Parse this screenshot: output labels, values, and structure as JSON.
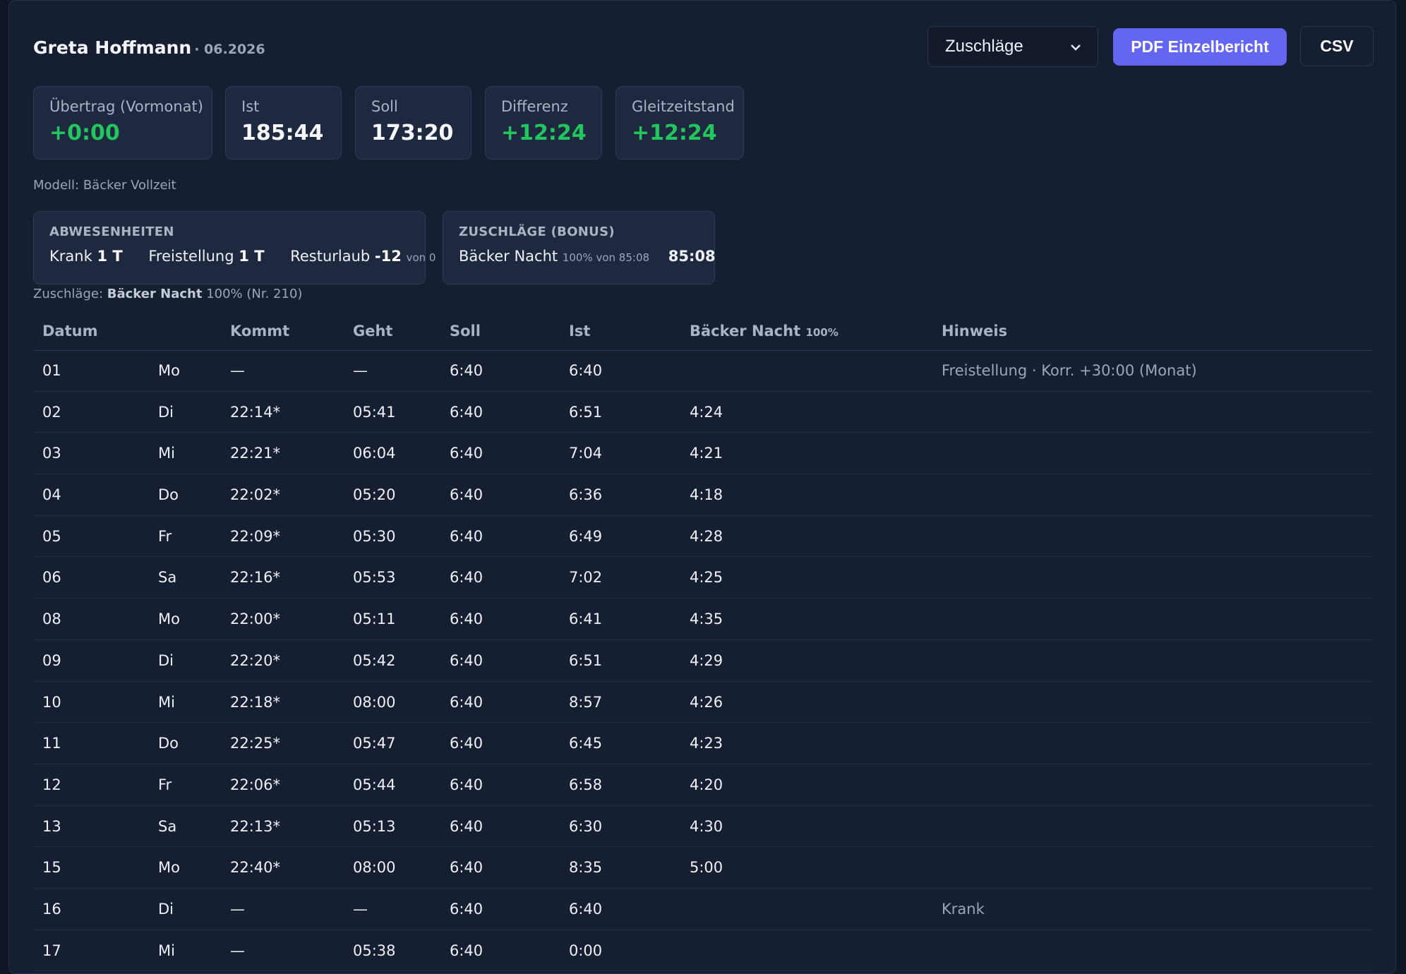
{
  "header": {
    "name": "Greta Hoffmann",
    "period": "· 06.2026",
    "select_value": "Zuschläge",
    "pdf_label": "PDF Einzelbericht",
    "csv_label": "CSV"
  },
  "stats": [
    {
      "label": "Übertrag (Vormonat)",
      "value": "+0:00"
    },
    {
      "label": "Ist",
      "value": "185:44"
    },
    {
      "label": "Soll",
      "value": "173:20"
    },
    {
      "label": "Differenz",
      "value": "+12:24"
    },
    {
      "label": "Gleitzeitstand",
      "value": "+12:24"
    }
  ],
  "model": "Modell: Bäcker Vollzeit",
  "absences": {
    "title": "ABWESENHEITEN",
    "krank_label": "Krank",
    "krank_value": "1 T",
    "freistellung_label": "Freistellung",
    "freistellung_value": "1 T",
    "resturlaub_label": "Resturlaub",
    "resturlaub_value": "-12",
    "resturlaub_suffix": "von 0"
  },
  "bonus": {
    "title": "ZUSCHLÄGE (BONUS)",
    "label": "Bäcker Nacht",
    "detail": "100% von 85:08",
    "value": "85:08"
  },
  "surcharge_note": {
    "prefix": "Zuschläge:",
    "name": "Bäcker Nacht",
    "suffix": "100% (Nr. 210)"
  },
  "table": {
    "headers": {
      "datum": "Datum",
      "kommt": "Kommt",
      "geht": "Geht",
      "soll": "Soll",
      "ist": "Ist",
      "bonus": "Bäcker Nacht",
      "bonus_pct": "100%",
      "hinweis": "Hinweis"
    },
    "rows": [
      {
        "day": "01",
        "wd": "Mo",
        "kommt": "—",
        "geht": "—",
        "soll": "6:40",
        "ist": "6:40",
        "bonus": "",
        "hint": "Freistellung · Korr. +30:00 (Monat)"
      },
      {
        "day": "02",
        "wd": "Di",
        "kommt": "22:14*",
        "geht": "05:41",
        "soll": "6:40",
        "ist": "6:51",
        "bonus": "4:24",
        "hint": ""
      },
      {
        "day": "03",
        "wd": "Mi",
        "kommt": "22:21*",
        "geht": "06:04",
        "soll": "6:40",
        "ist": "7:04",
        "bonus": "4:21",
        "hint": ""
      },
      {
        "day": "04",
        "wd": "Do",
        "kommt": "22:02*",
        "geht": "05:20",
        "soll": "6:40",
        "ist": "6:36",
        "bonus": "4:18",
        "hint": ""
      },
      {
        "day": "05",
        "wd": "Fr",
        "kommt": "22:09*",
        "geht": "05:30",
        "soll": "6:40",
        "ist": "6:49",
        "bonus": "4:28",
        "hint": ""
      },
      {
        "day": "06",
        "wd": "Sa",
        "kommt": "22:16*",
        "geht": "05:53",
        "soll": "6:40",
        "ist": "7:02",
        "bonus": "4:25",
        "hint": ""
      },
      {
        "day": "08",
        "wd": "Mo",
        "kommt": "22:00*",
        "geht": "05:11",
        "soll": "6:40",
        "ist": "6:41",
        "bonus": "4:35",
        "hint": ""
      },
      {
        "day": "09",
        "wd": "Di",
        "kommt": "22:20*",
        "geht": "05:42",
        "soll": "6:40",
        "ist": "6:51",
        "bonus": "4:29",
        "hint": ""
      },
      {
        "day": "10",
        "wd": "Mi",
        "kommt": "22:18*",
        "geht": "08:00",
        "soll": "6:40",
        "ist": "8:57",
        "bonus": "4:26",
        "hint": ""
      },
      {
        "day": "11",
        "wd": "Do",
        "kommt": "22:25*",
        "geht": "05:47",
        "soll": "6:40",
        "ist": "6:45",
        "bonus": "4:23",
        "hint": ""
      },
      {
        "day": "12",
        "wd": "Fr",
        "kommt": "22:06*",
        "geht": "05:44",
        "soll": "6:40",
        "ist": "6:58",
        "bonus": "4:20",
        "hint": ""
      },
      {
        "day": "13",
        "wd": "Sa",
        "kommt": "22:13*",
        "geht": "05:13",
        "soll": "6:40",
        "ist": "6:30",
        "bonus": "4:30",
        "hint": ""
      },
      {
        "day": "15",
        "wd": "Mo",
        "kommt": "22:40*",
        "geht": "08:00",
        "soll": "6:40",
        "ist": "8:35",
        "bonus": "5:00",
        "hint": ""
      },
      {
        "day": "16",
        "wd": "Di",
        "kommt": "—",
        "geht": "—",
        "soll": "6:40",
        "ist": "6:40",
        "bonus": "",
        "hint": "Krank"
      },
      {
        "day": "17",
        "wd": "Mi",
        "kommt": "—",
        "geht": "05:38",
        "soll": "6:40",
        "ist": "0:00",
        "bonus": "",
        "hint": ""
      }
    ]
  }
}
